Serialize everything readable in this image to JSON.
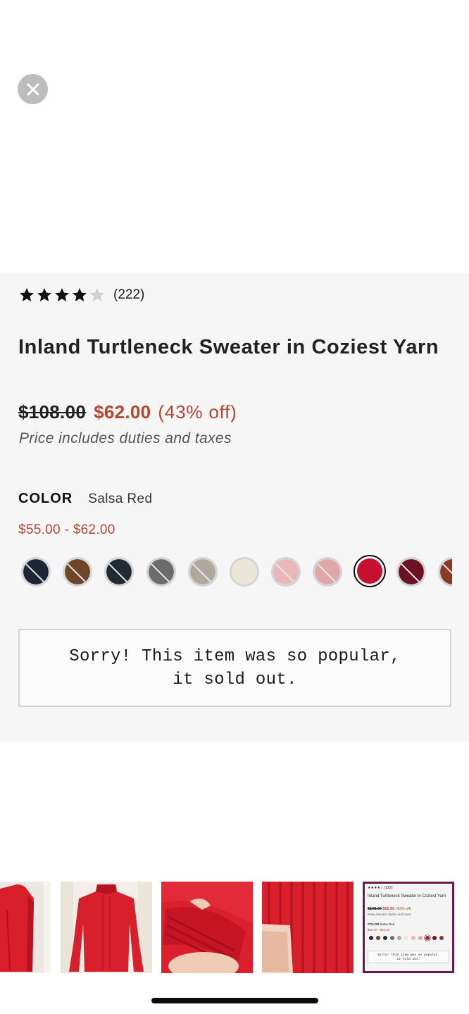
{
  "close_button": {
    "icon": "close-icon"
  },
  "product": {
    "rating": {
      "filled_stars": 4,
      "total_stars": 5,
      "count_text": "(222)"
    },
    "title": "Inland Turtleneck Sweater in Coziest Yarn",
    "price": {
      "original": "$108.00",
      "sale": "$62.00",
      "discount": "(43% off)"
    },
    "duties_note": "Price includes duties and taxes",
    "color": {
      "label": "COLOR",
      "selected": "Salsa Red",
      "price_range": "$55.00 - $62.00",
      "swatches": [
        {
          "color": "#1e2535",
          "sold_out": true
        },
        {
          "color": "#6e4527",
          "sold_out": true
        },
        {
          "color": "#222a31",
          "sold_out": true
        },
        {
          "color": "#6c6c6c",
          "sold_out": true
        },
        {
          "color": "#b0a89d",
          "sold_out": true
        },
        {
          "color": "#ece6d8",
          "sold_out": true
        },
        {
          "color": "#eab8b8",
          "sold_out": true
        },
        {
          "color": "#dfa7a7",
          "sold_out": true
        },
        {
          "color": "#c5102f",
          "sold_out": false,
          "selected": true
        },
        {
          "color": "#6a1124",
          "sold_out": true
        },
        {
          "color": "#8a3a24",
          "sold_out": true
        }
      ]
    },
    "sold_out_message": {
      "line1": "Sorry! This item was so popular,",
      "line2": "it sold out."
    }
  },
  "thumbnails": [
    {
      "kind": "photo",
      "description_icon": "sweater-back-photo"
    },
    {
      "kind": "photo",
      "description_icon": "sweater-front-photo"
    },
    {
      "kind": "photo",
      "description_icon": "sweater-cuff-photo"
    },
    {
      "kind": "photo",
      "description_icon": "sweater-hem-photo"
    },
    {
      "kind": "screenshot",
      "active": true
    }
  ],
  "mini_screenshot": {
    "count": "(222)",
    "title": "Inland Turtleneck Sweater in Coziest Yarn",
    "price_old": "$108.00",
    "price_new": "$62.00",
    "price_off": "(43% off)",
    "duties": "Price includes duties and taxes",
    "color_label": "COLOR",
    "color_value": "Salsa Red",
    "range": "$55.00 - $62.00",
    "msg1": "Sorry! This item was so popular,",
    "msg2": "it sold out."
  },
  "colors": {
    "accent": "#b5472f",
    "panel_bg": "#f6f6f6",
    "thumb_border": "#6b1b4f"
  }
}
